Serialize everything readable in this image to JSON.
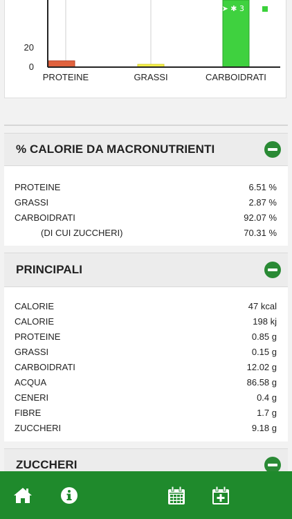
{
  "status": {
    "icons": "➤ ✱ 3"
  },
  "chart_data": {
    "type": "bar",
    "categories": [
      "PROTEINE",
      "GRASSI",
      "CARBOIDRATI"
    ],
    "values": [
      6.51,
      2.87,
      92.07
    ],
    "yticks": [
      "0",
      "20"
    ],
    "colors": [
      "#e0623e",
      "#f4f04a",
      "#3fd13f"
    ]
  },
  "sections": {
    "macro": {
      "title": "% CALORIE DA MACRONUTRIENTI",
      "rows": [
        {
          "label": "PROTEINE",
          "value": "6.51 %"
        },
        {
          "label": "GRASSI",
          "value": "2.87 %"
        },
        {
          "label": "CARBOIDRATI",
          "value": "92.07 %"
        },
        {
          "label": "(DI CUI ZUCCHERI)",
          "value": "70.31 %"
        }
      ]
    },
    "principali": {
      "title": "PRINCIPALI",
      "rows": [
        {
          "label": "CALORIE",
          "value": "47 kcal"
        },
        {
          "label": "CALORIE",
          "value": "198 kj"
        },
        {
          "label": "PROTEINE",
          "value": "0.85 g"
        },
        {
          "label": "GRASSI",
          "value": "0.15 g"
        },
        {
          "label": "CARBOIDRATI",
          "value": "12.02 g"
        },
        {
          "label": "ACQUA",
          "value": "86.58 g"
        },
        {
          "label": "CENERI",
          "value": "0.4 g"
        },
        {
          "label": "FIBRE",
          "value": "1.7 g"
        },
        {
          "label": "ZUCCHERI",
          "value": "9.18 g"
        }
      ]
    },
    "zuccheri": {
      "title": "ZUCCHERI"
    }
  },
  "nav": {
    "items": [
      "home-icon",
      "info-icon",
      "calendar-icon",
      "calendar-add-icon"
    ],
    "bar_color": "#1f8a2c"
  }
}
